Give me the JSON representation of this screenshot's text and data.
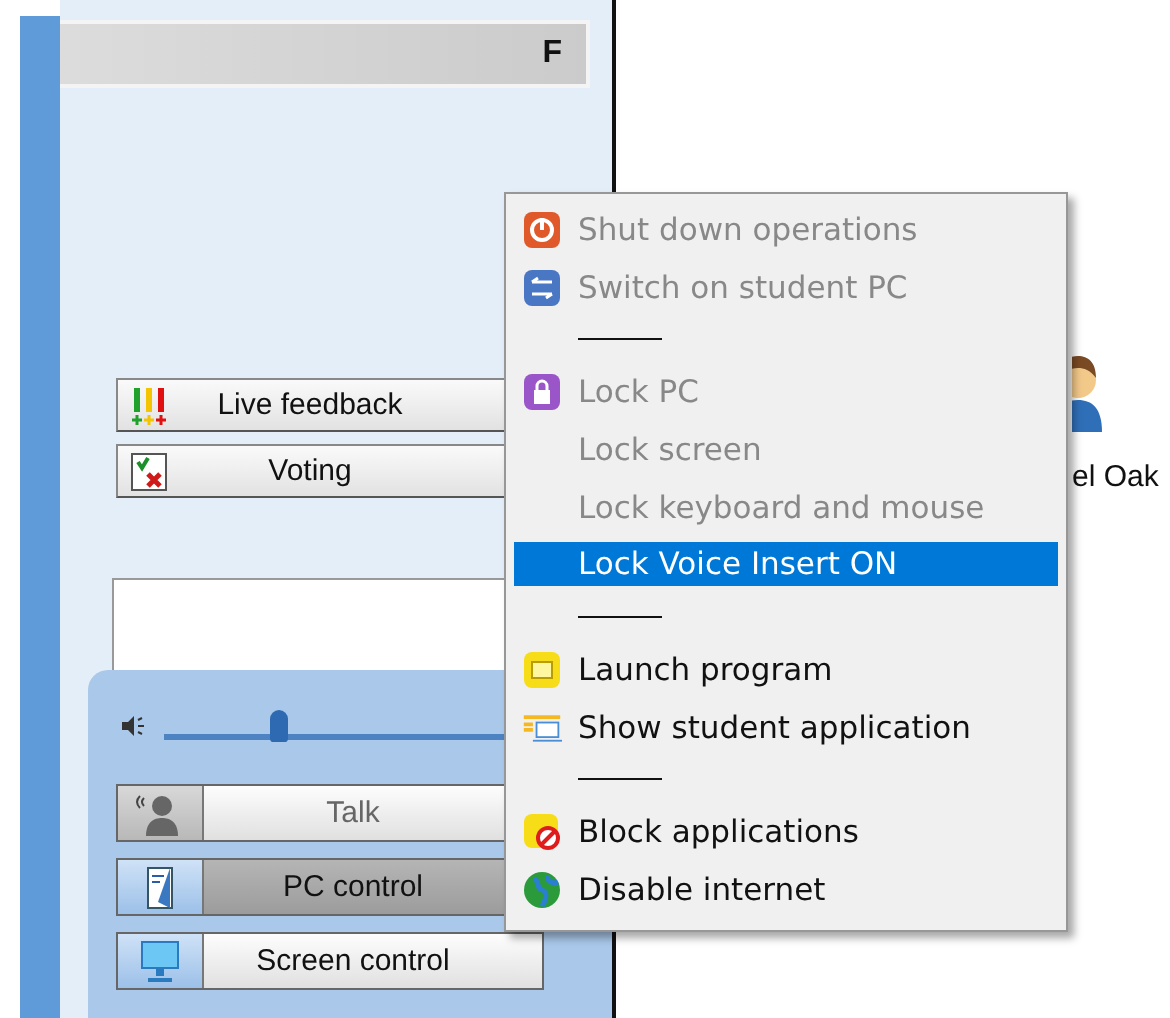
{
  "header": {
    "label": "F"
  },
  "panel_buttons": [
    {
      "label": "Live feedback",
      "kind": "feedback"
    },
    {
      "label": "Voting",
      "kind": "voting"
    }
  ],
  "audio": {
    "level": 0.3
  },
  "control_buttons": [
    {
      "label": "Talk",
      "kind": "talk",
      "disabled": true,
      "pressed": false
    },
    {
      "label": "PC control",
      "kind": "pc",
      "disabled": false,
      "pressed": true
    },
    {
      "label": "Screen control",
      "kind": "screen",
      "disabled": false,
      "pressed": false
    }
  ],
  "student": {
    "name": "el Oak"
  },
  "context_menu": [
    {
      "kind": "item",
      "label": "Shut down operations",
      "disabled": true,
      "selected": false
    },
    {
      "kind": "item",
      "label": "Switch on student PC",
      "disabled": true,
      "selected": false
    },
    {
      "kind": "separator"
    },
    {
      "kind": "item",
      "label": "Lock PC",
      "disabled": true,
      "selected": false
    },
    {
      "kind": "item",
      "label": "Lock screen",
      "disabled": true,
      "selected": false
    },
    {
      "kind": "item",
      "label": "Lock keyboard and mouse",
      "disabled": true,
      "selected": false
    },
    {
      "kind": "item",
      "label": "Lock Voice Insert ON",
      "disabled": false,
      "selected": true
    },
    {
      "kind": "separator"
    },
    {
      "kind": "item",
      "label": "Launch program",
      "disabled": false,
      "selected": false
    },
    {
      "kind": "item",
      "label": "Show student application",
      "disabled": false,
      "selected": false
    },
    {
      "kind": "separator"
    },
    {
      "kind": "item",
      "label": "Block applications",
      "disabled": false,
      "selected": false
    },
    {
      "kind": "item",
      "label": "Disable internet",
      "disabled": false,
      "selected": false
    }
  ]
}
